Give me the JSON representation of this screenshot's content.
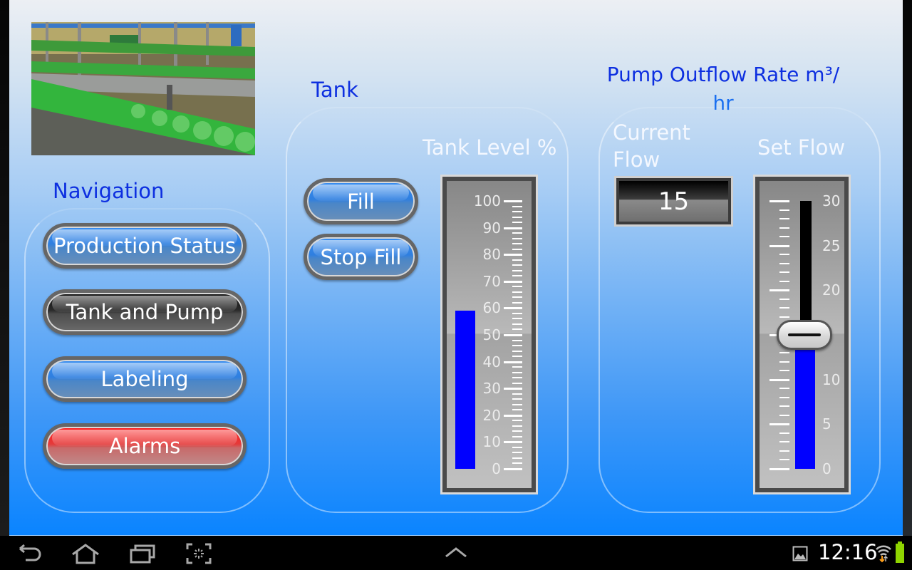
{
  "image": {
    "description": "Bottling line conveyor photo with green bottles"
  },
  "navigation": {
    "title": "Navigation",
    "items": [
      {
        "label": "Production Status",
        "style": "blue",
        "active": false
      },
      {
        "label": "Tank and Pump",
        "style": "dark",
        "active": true
      },
      {
        "label": "Labeling",
        "style": "blue",
        "active": false
      },
      {
        "label": "Alarms",
        "style": "red",
        "active": false
      }
    ]
  },
  "tank": {
    "title": "Tank",
    "fill_button": "Fill",
    "stop_fill_button": "Stop Fill",
    "level_label": "Tank Level %",
    "level_value_percent": 59,
    "scale": {
      "min": 0,
      "max": 100,
      "major_step": 10,
      "minor_per_major": 5,
      "labels": [
        "100",
        "90",
        "80",
        "70",
        "60",
        "50",
        "40",
        "30",
        "20",
        "10",
        "0"
      ]
    }
  },
  "pump": {
    "title_line1": "Pump Outflow Rate m³/",
    "title_line2": "hr",
    "current_flow_label_line1": "Current",
    "current_flow_label_line2": "Flow",
    "current_flow_value": "15",
    "set_flow_label": "Set Flow",
    "set_flow_value": 15,
    "scale": {
      "min": 0,
      "max": 30,
      "major_step": 5,
      "minor_per_major": 5,
      "labels": [
        "30",
        "25",
        "20",
        "",
        "10",
        "5",
        "0"
      ]
    }
  },
  "colors": {
    "fill_blue": "#0000ff",
    "title_blue": "#0d2fe0",
    "alarm_red": "#ff1a1a",
    "battery_green": "#8fd400"
  },
  "system_bar": {
    "back": "back-icon",
    "home": "home-icon",
    "recents": "recent-apps-icon",
    "screenshot": "screenshot-icon",
    "expand": "chevron-up-icon",
    "time": "12:16"
  }
}
